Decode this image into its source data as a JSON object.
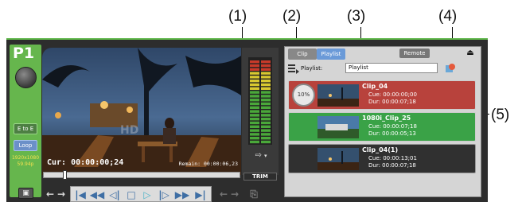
{
  "callouts": [
    "(1)",
    "(2)",
    "(3)",
    "(4)",
    "(5)"
  ],
  "channel": {
    "label": "P1",
    "e_to_e_label": "E to E",
    "loop_label": "Loop",
    "format_line1": "1920x1080",
    "format_line2": "59.94p"
  },
  "viewer": {
    "cur_label": "Cur: 00:00:00;24",
    "remain_label": "Remain: 00:00:06,23"
  },
  "trim_label": "TRIM",
  "playlist_panel": {
    "tab_clip": "Clip",
    "tab_playlist": "Playlist",
    "remote_label": "Remote",
    "playlist_label": "Playlist:",
    "playlist_value": "Playlist",
    "clips": [
      {
        "name": "Clip_04",
        "cue": "Cue: 00:00:00;00",
        "dur": "Dur: 00:00:07;18",
        "progress": "10%",
        "status_color": "#b8423c"
      },
      {
        "name": "1080i_Clip_25",
        "cue": "Cue: 00:00:07;18",
        "dur": "Dur: 00:00:05;13",
        "status_color": "#3aa247"
      },
      {
        "name": "Clip_04(1)",
        "cue": "Cue: 00:00:13;01",
        "dur": "Dur: 00:00:07;18",
        "status_color": "#303030"
      }
    ]
  },
  "colors": {
    "accent_green": "#5fb64a",
    "playing_red": "#b8423c",
    "cued_green": "#3aa247"
  }
}
